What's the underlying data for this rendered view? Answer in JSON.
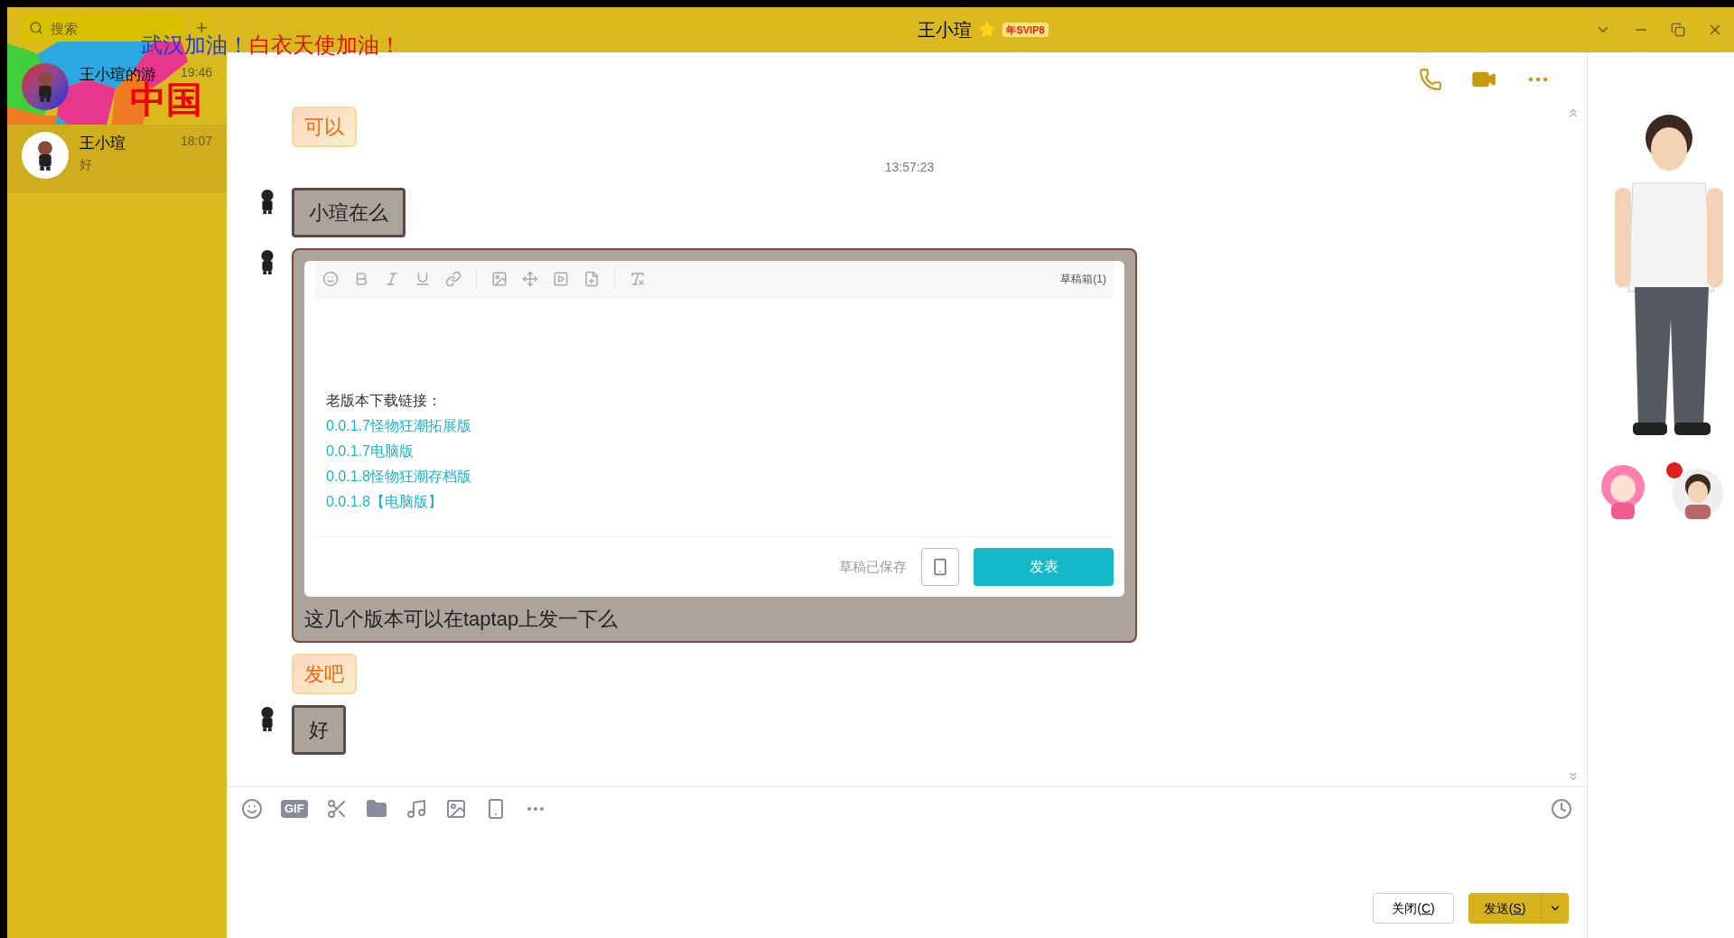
{
  "window": {
    "title": "王小瑄",
    "vip_badge": "年SVIP8"
  },
  "sidebar": {
    "search": {
      "placeholder": "搜索"
    },
    "add_button": "+",
    "banner": {
      "slogan_1": "武汉加油！",
      "slogan_2": "白衣天使加油！",
      "overlay": "中国"
    },
    "contacts": [
      {
        "name": "王小瑄的游",
        "time": "19:46",
        "selected": false
      },
      {
        "name": "王小瑄",
        "time": "18:07",
        "preview": "好",
        "selected": true
      }
    ]
  },
  "chat": {
    "messages": [
      {
        "kind": "sticker",
        "text": "可以"
      },
      {
        "kind": "timestamp",
        "text": "13:57:23"
      },
      {
        "kind": "stone",
        "text": "小瑄在么"
      },
      {
        "kind": "card",
        "draft_box": "草稿箱(1)",
        "heading": "老版本下载链接：",
        "links": [
          "0.0.1.7怪物狂潮拓展版",
          "0.0.1.7电脑版",
          "0.0.1.8怪物狂潮存档版",
          "0.0.1.8【电脑版】"
        ],
        "saved_note": "草稿已保存",
        "publish_button": "发表",
        "text": "这几个版本可以在taptap上发一下么"
      },
      {
        "kind": "sticker",
        "text": "发吧"
      },
      {
        "kind": "stone",
        "text": "好"
      }
    ]
  },
  "composer": {
    "gif_label": "GIF",
    "buttons": [
      "关闭(C)",
      "发送(S)"
    ]
  }
}
